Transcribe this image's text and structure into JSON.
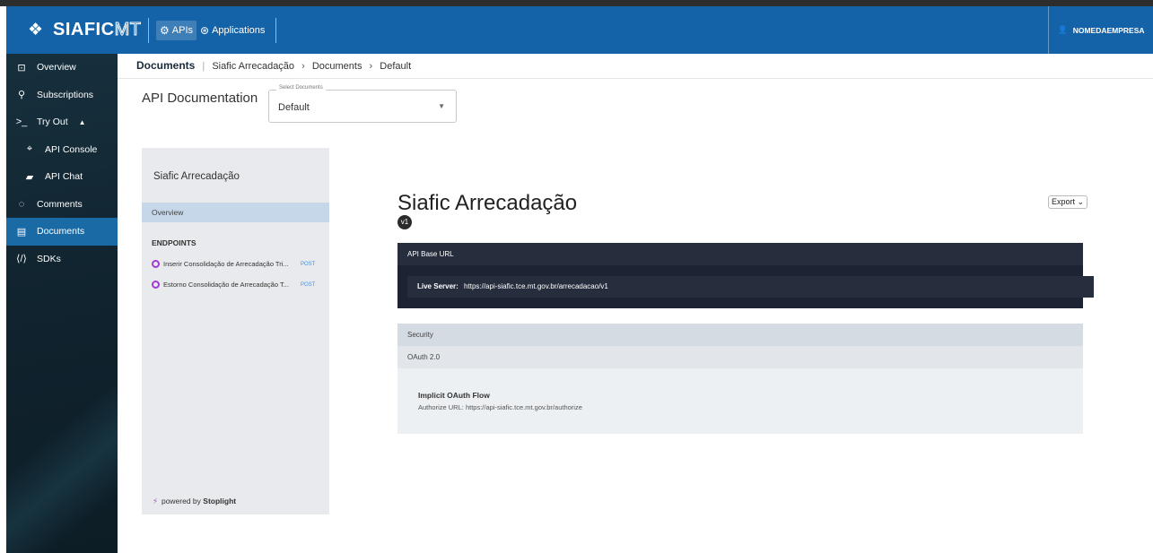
{
  "topbar": {
    "brand": "SIAFIC",
    "brand_suffix": "MT",
    "nav": [
      {
        "label": "APIs",
        "icon": "gear-icon"
      },
      {
        "label": "Applications",
        "icon": "apps-icon"
      }
    ],
    "user": "NOMEDAEMPRESA",
    "bar_color": "#1463a8"
  },
  "sidebar": {
    "items": [
      {
        "label": "Overview",
        "icon": "overview-icon"
      },
      {
        "label": "Subscriptions",
        "icon": "subscriptions-icon"
      },
      {
        "label": "Try Out",
        "icon": "terminal-icon"
      },
      {
        "label": "API Console",
        "icon": "console-icon"
      },
      {
        "label": "API Chat",
        "icon": "chat-icon"
      },
      {
        "label": "Comments",
        "icon": "comments-icon"
      },
      {
        "label": "Documents",
        "icon": "documents-icon"
      },
      {
        "label": "SDKs",
        "icon": "code-icon"
      }
    ],
    "active": "Documents",
    "active_color": "#1a6aa6"
  },
  "breadcrumb": {
    "root": "Documents",
    "items": [
      "Siafic Arrecadação",
      "Documents",
      "Default"
    ]
  },
  "api_doc": {
    "title": "API Documentation",
    "select_label": "Select Documents",
    "select_value": "Default"
  },
  "doc_nav": {
    "title": "Siafic Arrecadação",
    "overview": "Overview",
    "endpoints_heading": "ENDPOINTS",
    "endpoints": [
      {
        "name": "Inserir Consolidação de Arrecadação Tri...",
        "method": "POST"
      },
      {
        "name": "Estorno Consolidação de Arrecadação T...",
        "method": "POST"
      }
    ],
    "powered_by": "powered by",
    "powered_brand": "Stoplight"
  },
  "main": {
    "title": "Siafic Arrecadação",
    "version": "v1",
    "export": "Export",
    "base_url_heading": "API Base URL",
    "server_label": "Live Server:",
    "server_url": "https://api-siafic.tce.mt.gov.br/arrecadacao/v1",
    "security_heading": "Security",
    "oauth_label": "OAuth 2.0",
    "flow_title": "Implicit OAuth Flow",
    "authorize_label": "Authorize URL:",
    "authorize_url": "https://api-siafic.tce.mt.gov.br/authorize"
  }
}
